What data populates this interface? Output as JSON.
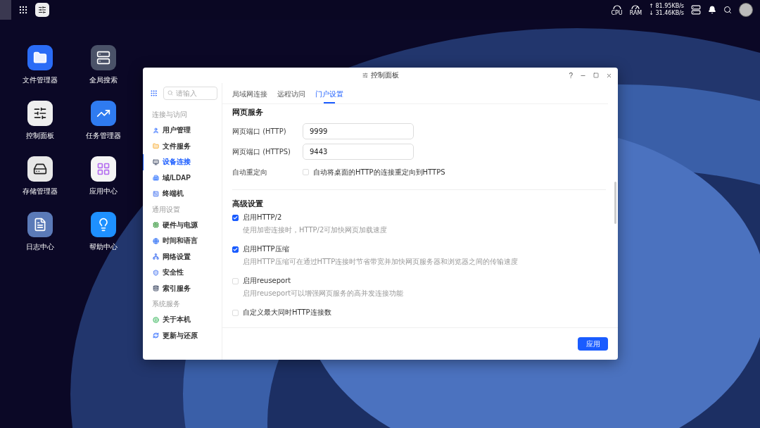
{
  "top_bar": {
    "monitors": [
      {
        "kind": "cpu",
        "label": "CPU"
      },
      {
        "kind": "ram",
        "label": "RAM"
      }
    ],
    "upload": "↑ 81.95KB/s",
    "download": "↓ 31.46KB/s"
  },
  "desktop_icons": [
    {
      "kind": "folder",
      "label": "文件管理器"
    },
    {
      "kind": "search",
      "label": "全局搜索"
    },
    {
      "kind": "sliders",
      "label": "控制面板"
    },
    {
      "kind": "chart",
      "label": "任务管理器"
    },
    {
      "kind": "storage",
      "label": "存储管理器"
    },
    {
      "kind": "apps",
      "label": "应用中心"
    },
    {
      "kind": "log",
      "label": "日志中心"
    },
    {
      "kind": "help",
      "label": "帮助中心"
    }
  ],
  "window": {
    "title": "控制面板",
    "help": "?"
  },
  "sidebar": {
    "search": {
      "placeholder": "请输入"
    },
    "groups": [
      {
        "title": "连接与访问",
        "items": [
          {
            "kind": "user",
            "label": "用户管理",
            "selected": false
          },
          {
            "kind": "folder",
            "label": "文件服务",
            "selected": false
          },
          {
            "kind": "monitor",
            "label": "设备连接",
            "selected": true
          },
          {
            "kind": "domain",
            "label": "域/LDAP",
            "selected": false
          },
          {
            "kind": "terminal",
            "label": "终端机",
            "selected": false
          }
        ]
      },
      {
        "title": "通用设置",
        "items": [
          {
            "kind": "hardware",
            "label": "硬件与电源",
            "selected": false
          },
          {
            "kind": "globe",
            "label": "时间和语言",
            "selected": false
          },
          {
            "kind": "network",
            "label": "网络设置",
            "selected": false
          },
          {
            "kind": "shield",
            "label": "安全性",
            "selected": false
          },
          {
            "kind": "index",
            "label": "索引服务",
            "selected": false
          }
        ]
      },
      {
        "title": "系统服务",
        "items": [
          {
            "kind": "info",
            "label": "关于本机",
            "selected": false
          },
          {
            "kind": "refresh",
            "label": "更新与还原",
            "selected": false
          }
        ]
      }
    ]
  },
  "tabs": [
    {
      "label": "局域网连接",
      "selected": false
    },
    {
      "label": "远程访问",
      "selected": false
    },
    {
      "label": "门户设置",
      "selected": true
    }
  ],
  "web_service": {
    "title": "网页服务",
    "fields": [
      {
        "label": "网页端口 (HTTP)",
        "value": "9999"
      },
      {
        "label": "网页端口 (HTTPS)",
        "value": "9443"
      }
    ],
    "redirect": {
      "label": "自动重定向",
      "option": "自动将桌面的HTTP的连接重定向到HTTPS",
      "checked": false
    }
  },
  "advanced": {
    "title": "高级设置",
    "options": [
      {
        "label": "启用HTTP/2",
        "description": "使用加密连接时，HTTP/2可加快网页加载速度",
        "checked": true
      },
      {
        "label": "启用HTTP压缩",
        "description": "启用HTTP压缩可在通过HTTP连接时节省带宽并加快网页服务器和浏览器之间的传输速度",
        "checked": true
      },
      {
        "label": "启用reuseport",
        "description": "启用reuseport可以增强网页服务的高并发连接功能",
        "checked": false
      },
      {
        "label": "自定义最大同时HTTP连接数",
        "checked": false
      }
    ]
  },
  "apply_button": "应用"
}
